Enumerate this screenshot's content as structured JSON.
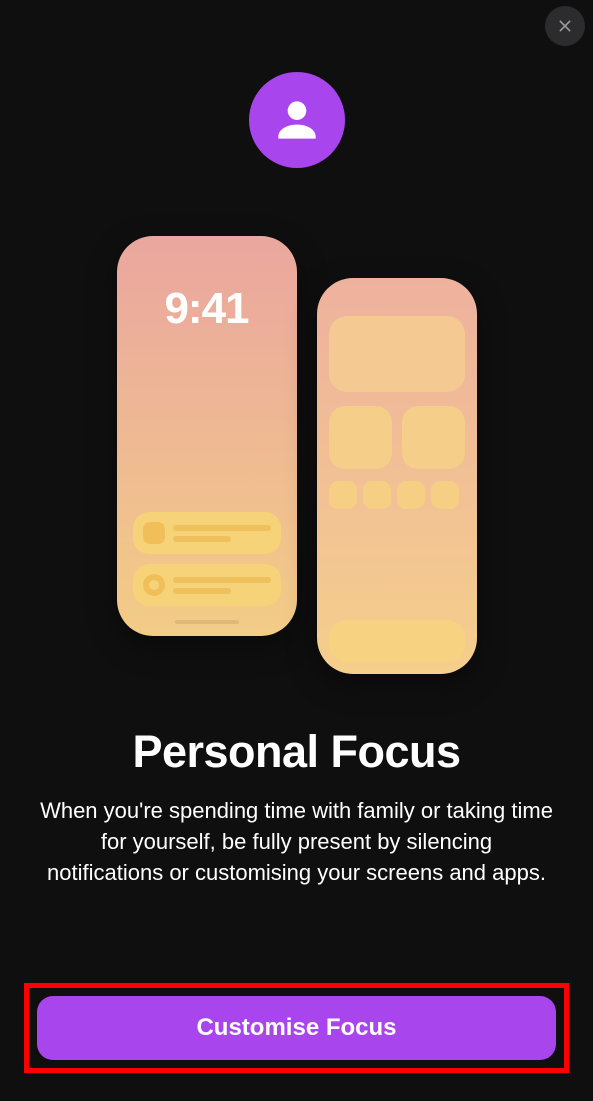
{
  "closeButton": {
    "label": "Close"
  },
  "avatar": {
    "icon": "person-icon",
    "color": "#a845ed"
  },
  "illustration": {
    "lockScreenTime": "9:41",
    "highlightColor": "#ff0000"
  },
  "title": "Personal Focus",
  "description": "When you're spending time with family or taking time for yourself, be fully present by silencing notifications or customising your screens and apps.",
  "cta": {
    "label": "Customise Focus"
  }
}
